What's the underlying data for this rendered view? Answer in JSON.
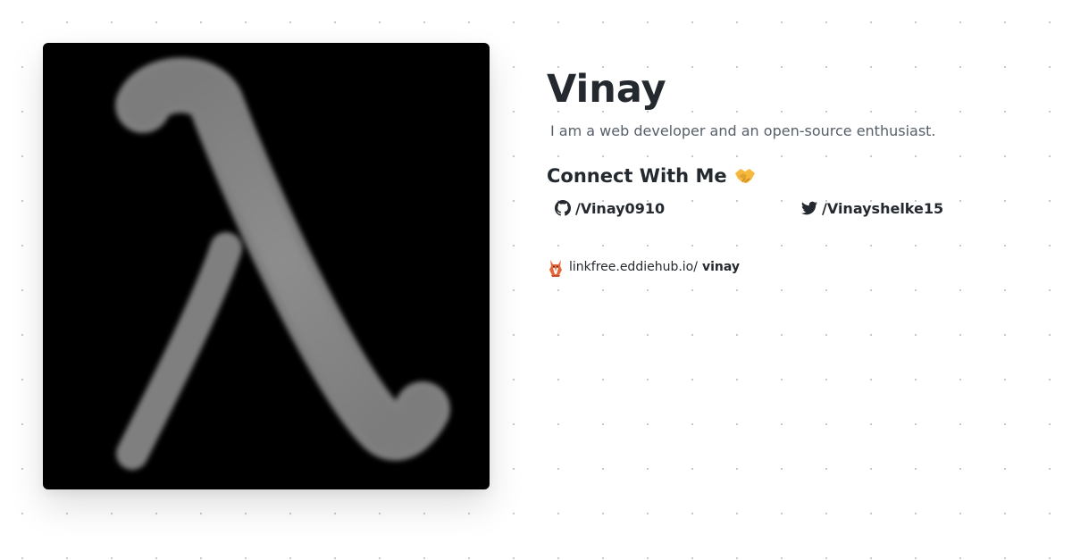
{
  "profile": {
    "name": "Vinay",
    "bio": "I am a web developer and an open-source enthusiast.",
    "avatar_icon": "lambda-icon"
  },
  "connect": {
    "heading": "Connect With Me",
    "heading_emoji": "handshake-icon",
    "links": [
      {
        "icon": "github-icon",
        "label": "/Vinay0910"
      },
      {
        "icon": "twitter-icon",
        "label": "/Vinayshelke15"
      }
    ]
  },
  "linkfree": {
    "icon": "eddiehub-fox-icon",
    "prefix": "linkfree.eddiehub.io/",
    "username": "vinay"
  },
  "colors": {
    "text": "#24292f",
    "muted": "#57606a",
    "avatar_bg": "#000000",
    "lambda": "#8a8a8a"
  }
}
